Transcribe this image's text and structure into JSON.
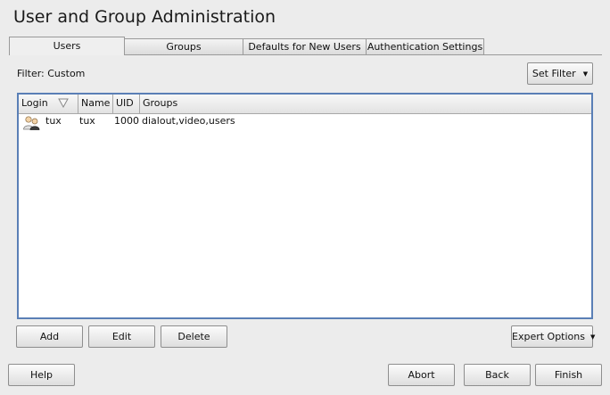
{
  "window": {
    "title": "User and Group Administration"
  },
  "tabs": [
    {
      "label": "Users"
    },
    {
      "label": "Groups"
    },
    {
      "label": "Defaults for New Users"
    },
    {
      "label": "Authentication Settings"
    }
  ],
  "filter": {
    "label": "Filter: Custom",
    "set_filter_button": "Set Filter"
  },
  "table": {
    "columns": [
      "Login",
      "Name",
      "UID",
      "Groups"
    ],
    "rows": [
      {
        "login": "tux",
        "name": "tux",
        "uid": "1000",
        "groups": "dialout,video,users"
      }
    ]
  },
  "actions": {
    "add": "Add",
    "edit": "Edit",
    "delete": "Delete",
    "expert_options": "Expert Options"
  },
  "footer": {
    "help": "Help",
    "abort": "Abort",
    "back": "Back",
    "finish": "Finish"
  },
  "icons": {
    "sort": "sort-descending-icon",
    "row": "user-icon",
    "dropdown": "caret-down-icon"
  },
  "colors": {
    "table_border": "#5a7fb6",
    "background": "#ececec"
  }
}
